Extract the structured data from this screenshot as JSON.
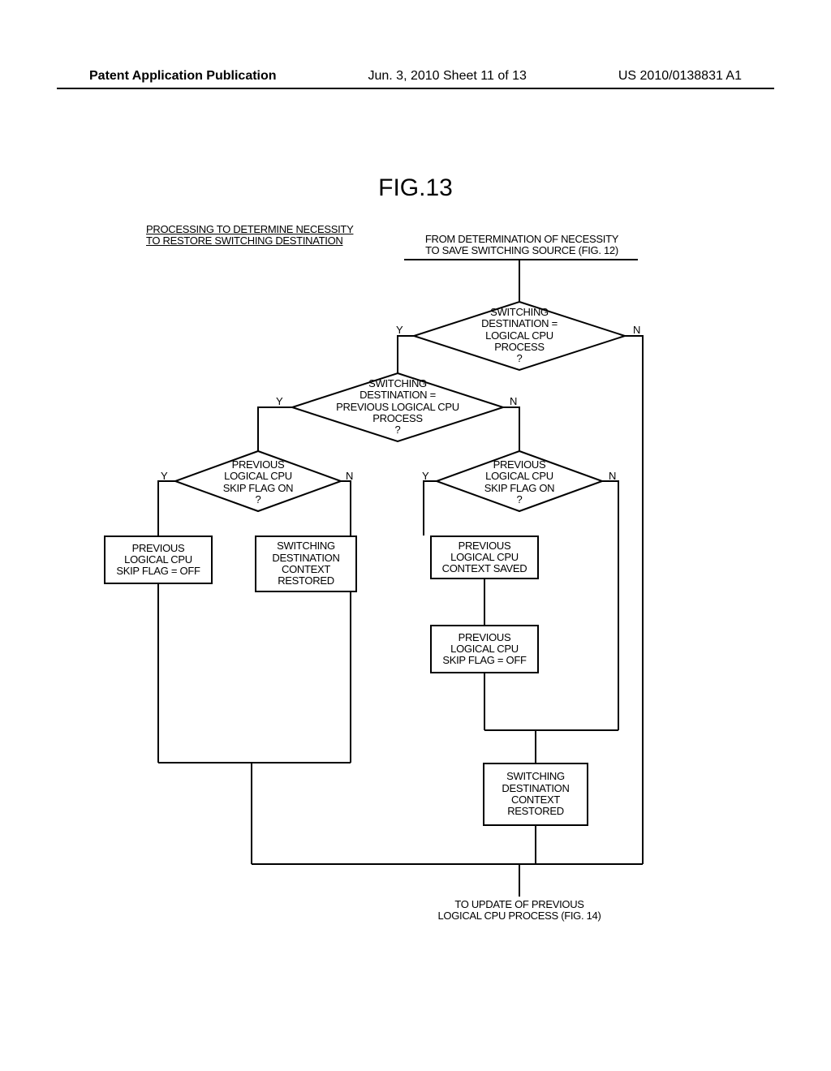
{
  "header": {
    "left": "Patent Application Publication",
    "center": "Jun. 3, 2010  Sheet 11 of 13",
    "right": "US 2010/0138831 A1"
  },
  "figure_label": "FIG.13",
  "labels": {
    "title": "PROCESSING TO DETERMINE NECESSITY\nTO RESTORE SWITCHING DESTINATION",
    "from": "FROM DETERMINATION OF NECESSITY\nTO SAVE SWITCHING SOURCE (FIG. 12)",
    "to": "TO UPDATE OF PREVIOUS\nLOGICAL CPU PROCESS (FIG. 14)"
  },
  "decisions": {
    "d1": "SWITCHING\nDESTINATION =\nLOGICAL CPU\nPROCESS\n?",
    "d2": "SWITCHING\nDESTINATION =\nPREVIOUS LOGICAL CPU\nPROCESS\n?",
    "d3": "PREVIOUS\nLOGICAL CPU\nSKIP FLAG ON\n?",
    "d4": "PREVIOUS\nLOGICAL CPU\nSKIP FLAG ON\n?"
  },
  "processes": {
    "p1": "PREVIOUS\nLOGICAL CPU\nSKIP FLAG = OFF",
    "p2": "SWITCHING\nDESTINATION\nCONTEXT\nRESTORED",
    "p3": "PREVIOUS\nLOGICAL CPU\nCONTEXT SAVED",
    "p4": "PREVIOUS\nLOGICAL CPU\nSKIP FLAG = OFF",
    "p5": "SWITCHING\nDESTINATION\nCONTEXT\nRESTORED"
  },
  "yn": {
    "y": "Y",
    "n": "N"
  }
}
